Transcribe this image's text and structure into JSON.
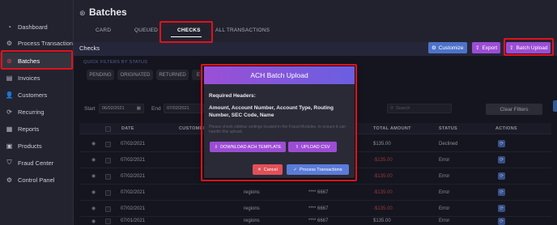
{
  "sidebar": {
    "items": [
      {
        "label": "Dashboard",
        "icon": "dashboard-icon",
        "glyph": "◔"
      },
      {
        "label": "Process Transaction",
        "icon": "gear-icon",
        "glyph": "⚙"
      },
      {
        "label": "Batches",
        "icon": "batches-icon",
        "glyph": "⊛"
      },
      {
        "label": "Invoices",
        "icon": "invoice-icon",
        "glyph": "▤"
      },
      {
        "label": "Customers",
        "icon": "customers-icon",
        "glyph": "👤"
      },
      {
        "label": "Recurring",
        "icon": "recurring-icon",
        "glyph": "⟳"
      },
      {
        "label": "Reports",
        "icon": "reports-icon",
        "glyph": "▦"
      },
      {
        "label": "Products",
        "icon": "products-icon",
        "glyph": "▣"
      },
      {
        "label": "Fraud Center",
        "icon": "shield-icon",
        "glyph": "⛉"
      },
      {
        "label": "Control Panel",
        "icon": "control-panel-icon",
        "glyph": "⚙"
      }
    ]
  },
  "header": {
    "title": "Batches",
    "tabs": [
      "CARD",
      "QUEUED",
      "CHECKS",
      "ALL TRANSACTIONS"
    ],
    "active_tab": "CHECKS"
  },
  "section": {
    "label": "Checks",
    "buttons": {
      "customize": "Customize",
      "export": "Export",
      "batch_upload": "Batch Upload"
    }
  },
  "quick_filters": {
    "label": "QUICK FILTERS BY STATUS",
    "chips": [
      "PENDING",
      "ORIGINATED",
      "RETURNED",
      "E"
    ]
  },
  "filters": {
    "start_label": "Start",
    "start_value": "06/02/2021",
    "end_label": "End",
    "end_value": "07/02/2021",
    "search_placeholder": "Search",
    "clear_label": "Clear Filters"
  },
  "table": {
    "headers": [
      "DATE",
      "CUSTOMER",
      "TOTAL AMOUNT",
      "STATUS",
      "ACTIONS"
    ],
    "rows": [
      {
        "date": "07/02/2021",
        "customer": "",
        "account": "",
        "amount": "$135.00",
        "status": "Declined"
      },
      {
        "date": "07/02/2021",
        "customer": "",
        "account": "",
        "amount": "-$135.00",
        "status": "Error"
      },
      {
        "date": "07/02/2021",
        "customer": "",
        "account": "",
        "amount": "-$135.00",
        "status": "Error"
      },
      {
        "date": "07/02/2021",
        "customer": "regions",
        "account": "**** 6667",
        "amount": "-$135.00",
        "status": "Error"
      },
      {
        "date": "07/02/2021",
        "customer": "regions",
        "account": "**** 6667",
        "amount": "-$135.00",
        "status": "Error"
      },
      {
        "date": "07/01/2021",
        "customer": "regions",
        "account": "**** 6667",
        "amount": "$135.00",
        "status": "Error"
      }
    ]
  },
  "modal": {
    "title": "ACH Batch Upload",
    "required_label": "Required Headers:",
    "headers_text": "Amount, Account Number, Account Type, Routing Number, SEC Code, Name",
    "note": "Please check sidebar settings located in the Fraud Modules, to ensure it can handle this upload.",
    "download_label": "DOWNLOAD ACH TEMPLATE",
    "upload_label": "UPLOAD CSV",
    "cancel_label": "Cancel",
    "process_label": "Process Transactions"
  },
  "colors": {
    "accent_purple": "#9c4dd4",
    "accent_blue": "#4d73c9",
    "error_red": "#e0121c",
    "negative_amount": "#d9534f"
  }
}
